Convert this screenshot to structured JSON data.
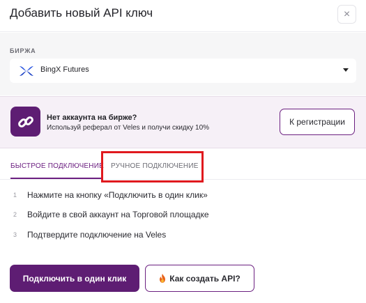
{
  "modal": {
    "title": "Добавить новый API ключ",
    "close_icon": "×"
  },
  "exchange": {
    "label": "БИРЖА",
    "selected": "BingX Futures",
    "logo_icon": "bingx-logo-icon",
    "dropdown_icon": "caret-down-icon"
  },
  "promo": {
    "title": "Нет аккаунта на бирже?",
    "subtitle": "Используй реферал от Veles и получи скидку 10%",
    "button_label": "К регистрации",
    "icon": "link-icon"
  },
  "tabs": {
    "fast": "БЫСТРОЕ ПОДКЛЮЧЕНИЕ",
    "manual": "РУЧНОЕ ПОДКЛЮЧЕНИЕ",
    "active": "fast"
  },
  "steps": [
    {
      "num": "1",
      "text": "Нажмите на кнопку «Подключить в один клик»"
    },
    {
      "num": "2",
      "text": "Войдите в свой аккаунт на Торговой площадке"
    },
    {
      "num": "3",
      "text": "Подтвердите подключение на Veles"
    }
  ],
  "actions": {
    "primary_label": "Подключить в один клик",
    "secondary_label": "Как создать API?",
    "secondary_icon": "fire-icon"
  },
  "colors": {
    "accent": "#5e1d73",
    "highlight": "#e0191e",
    "promo_bg": "#f6f0f7"
  }
}
